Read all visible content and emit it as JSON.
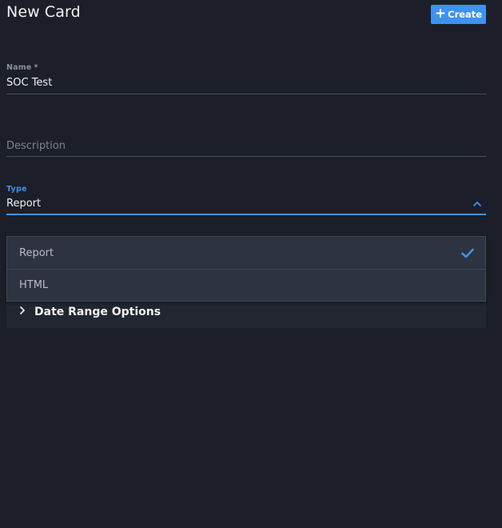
{
  "header": {
    "title": "New Card",
    "create_label": "Create"
  },
  "form": {
    "name": {
      "label": "Name",
      "required_mark": "*",
      "value": "SOC Test"
    },
    "description": {
      "placeholder": "Description",
      "value": ""
    },
    "type": {
      "label": "Type",
      "value": "Report",
      "expanded": true
    }
  },
  "dropdown": {
    "options": [
      {
        "label": "Report",
        "selected": true
      },
      {
        "label": "HTML",
        "selected": false
      }
    ]
  },
  "date_range": {
    "label": "Date Range Options",
    "expanded": false
  },
  "colors": {
    "background": "#1c1f29",
    "accent": "#3c92f0",
    "dropdown_bg": "#2d3340",
    "section_bg": "#222630"
  },
  "icons": {
    "create": "plus-icon",
    "type_toggle": "chevron-up-icon",
    "selected": "check-icon",
    "section_toggle": "chevron-right-icon"
  }
}
